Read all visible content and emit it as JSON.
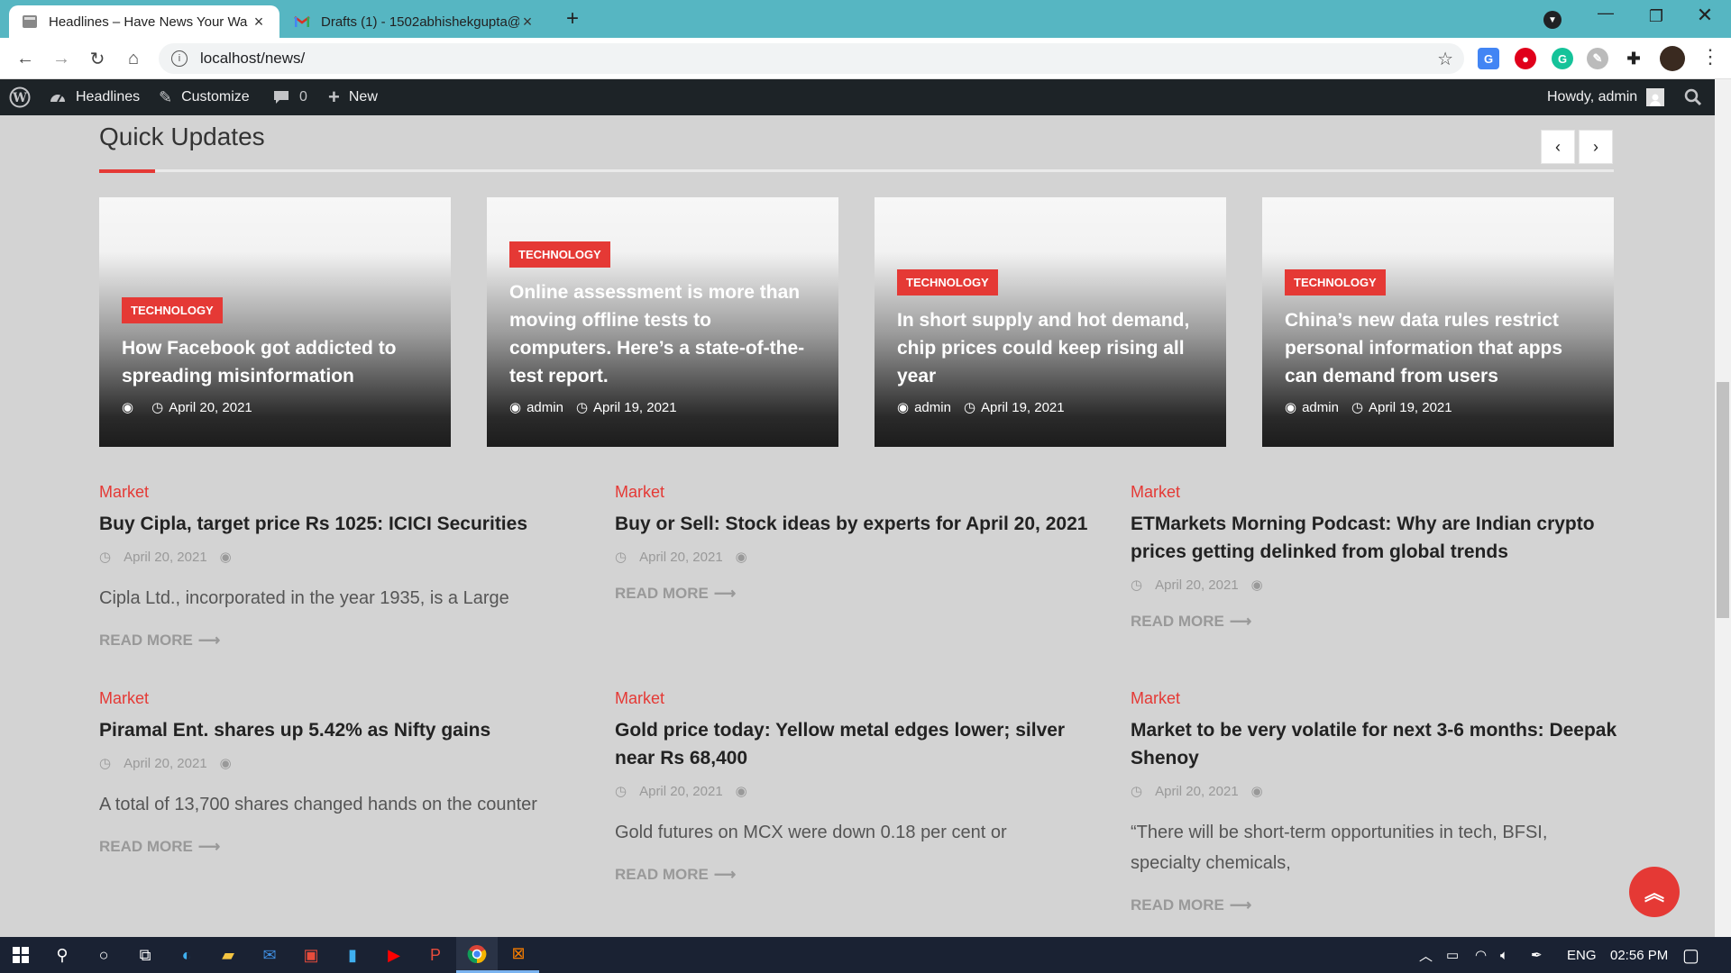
{
  "browser": {
    "tabs": [
      {
        "title": "Headlines – Have News Your Wa"
      },
      {
        "title": "Drafts (1) - 1502abhishekgupta@"
      }
    ],
    "url": "localhost/news/"
  },
  "adminbar": {
    "site": "Headlines",
    "customize": "Customize",
    "comments_count": "0",
    "new": "New",
    "greeting": "Howdy, admin"
  },
  "section": {
    "title": "Quick Updates"
  },
  "slider": [
    {
      "badge": "TECHNOLOGY",
      "title": "How Facebook got addicted to spreading misinformation",
      "author": "",
      "date": "April 20, 2021"
    },
    {
      "badge": "TECHNOLOGY",
      "title": "Online assessment is more than moving offline tests to computers. Here’s a state-of-the-test report.",
      "author": "admin",
      "date": "April 19, 2021"
    },
    {
      "badge": "TECHNOLOGY",
      "title": "In short supply and hot demand, chip prices could keep rising all year",
      "author": "admin",
      "date": "April 19, 2021"
    },
    {
      "badge": "TECHNOLOGY",
      "title": "China’s new data rules restrict personal information that apps can demand from users",
      "author": "admin",
      "date": "April 19, 2021"
    }
  ],
  "posts": [
    {
      "category": "Market",
      "title": "Buy Cipla, target price Rs 1025: ICICI Securities",
      "date": "April 20, 2021",
      "excerpt": "Cipla Ltd., incorporated in the year 1935, is a Large",
      "read_more": "READ MORE"
    },
    {
      "category": "Market",
      "title": "Buy or Sell: Stock ideas by experts for April 20, 2021",
      "date": "April 20, 2021",
      "excerpt": "",
      "read_more": "READ MORE"
    },
    {
      "category": "Market",
      "title": "ETMarkets Morning Podcast: Why are Indian crypto prices getting delinked from global trends",
      "date": "April 20, 2021",
      "excerpt": "",
      "read_more": "READ MORE"
    },
    {
      "category": "Market",
      "title": "Piramal Ent. shares up 5.42% as Nifty gains",
      "date": "April 20, 2021",
      "excerpt": "A total of 13,700 shares changed hands on the counter",
      "read_more": "READ MORE"
    },
    {
      "category": "Market",
      "title": "Gold price today: Yellow metal edges lower; silver near Rs 68,400",
      "date": "April 20, 2021",
      "excerpt": "Gold futures on MCX were down 0.18 per cent or",
      "read_more": "READ MORE"
    },
    {
      "category": "Market",
      "title": "Market to be very volatile for next 3-6 months: Deepak Shenoy",
      "date": "April 20, 2021",
      "excerpt": "“There will be short-term opportunities in tech, BFSI, specialty chemicals,",
      "read_more": "READ MORE"
    }
  ],
  "taskbar": {
    "lang": "ENG",
    "time": "02:56 PM"
  },
  "colors": {
    "accent": "#e53935",
    "tabbar": "#56b6c2",
    "adminbar": "#1d2327",
    "taskbar": "#1a2233"
  }
}
